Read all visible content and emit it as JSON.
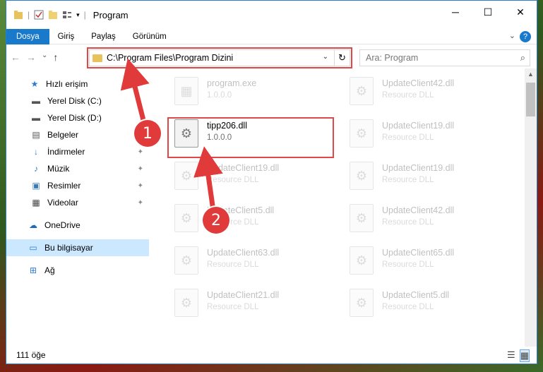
{
  "window": {
    "title": "Program",
    "controls": {
      "minimize": "─",
      "maximize": "☐",
      "close": "✕"
    }
  },
  "ribbon": {
    "tabs": [
      {
        "label": "Dosya",
        "active": true
      },
      {
        "label": "Giriş",
        "active": false
      },
      {
        "label": "Paylaş",
        "active": false
      },
      {
        "label": "Görünüm",
        "active": false
      }
    ],
    "help": "?",
    "chevron": "⌄"
  },
  "address": {
    "path": "C:\\Program Files\\Program Dizini",
    "dropdown": "⌄",
    "refresh": "↻"
  },
  "search": {
    "placeholder": "Ara: Program",
    "icon": "⌕"
  },
  "nav": {
    "back": "←",
    "forward": "→",
    "recent": "⌄",
    "up": "↑"
  },
  "sidebar": {
    "items": [
      {
        "label": "Hızlı erişim",
        "icon": "★",
        "pinned": false
      },
      {
        "label": "Yerel Disk (C:)",
        "icon": "▬",
        "pinned": false
      },
      {
        "label": "Yerel Disk (D:)",
        "icon": "▬",
        "pinned": false
      },
      {
        "label": "Belgeler",
        "icon": "▤",
        "pinned": true
      },
      {
        "label": "İndirmeler",
        "icon": "↓",
        "pinned": true
      },
      {
        "label": "Müzik",
        "icon": "♪",
        "pinned": true
      },
      {
        "label": "Resimler",
        "icon": "▣",
        "pinned": true
      },
      {
        "label": "Videolar",
        "icon": "▦",
        "pinned": true
      },
      {
        "label": "OneDrive",
        "icon": "☁",
        "pinned": false
      },
      {
        "label": "Bu bilgisayar",
        "icon": "▭",
        "pinned": false,
        "selected": true
      },
      {
        "label": "Ağ",
        "icon": "⊞",
        "pinned": false
      }
    ],
    "pin_glyph": "📌"
  },
  "files": {
    "left": [
      {
        "name": "program.exe",
        "sub": "1.0.0.0"
      },
      {
        "name": "tipp206.dll",
        "sub": "1.0.0.0"
      },
      {
        "name": "UpdateClient19.dll",
        "sub": "Resource DLL"
      },
      {
        "name": "UpdateClient5.dll",
        "sub": "Resource DLL"
      },
      {
        "name": "UpdateClient63.dll",
        "sub": "Resource DLL"
      },
      {
        "name": "UpdateClient21.dll",
        "sub": "Resource DLL"
      }
    ],
    "right": [
      {
        "name": "UpdateClient42.dll",
        "sub": "Resource DLL"
      },
      {
        "name": "UpdateClient19.dll",
        "sub": "Resource DLL"
      },
      {
        "name": "UpdateClient19.dll",
        "sub": "Resource DLL"
      },
      {
        "name": "UpdateClient42.dll",
        "sub": "Resource DLL"
      },
      {
        "name": "UpdateClient65.dll",
        "sub": "Resource DLL"
      },
      {
        "name": "UpdateClient5.dll",
        "sub": "Resource DLL"
      }
    ]
  },
  "status": {
    "count": "111 öğe"
  },
  "annotations": {
    "step1": "1",
    "step2": "2",
    "color": "#e03a3a"
  }
}
